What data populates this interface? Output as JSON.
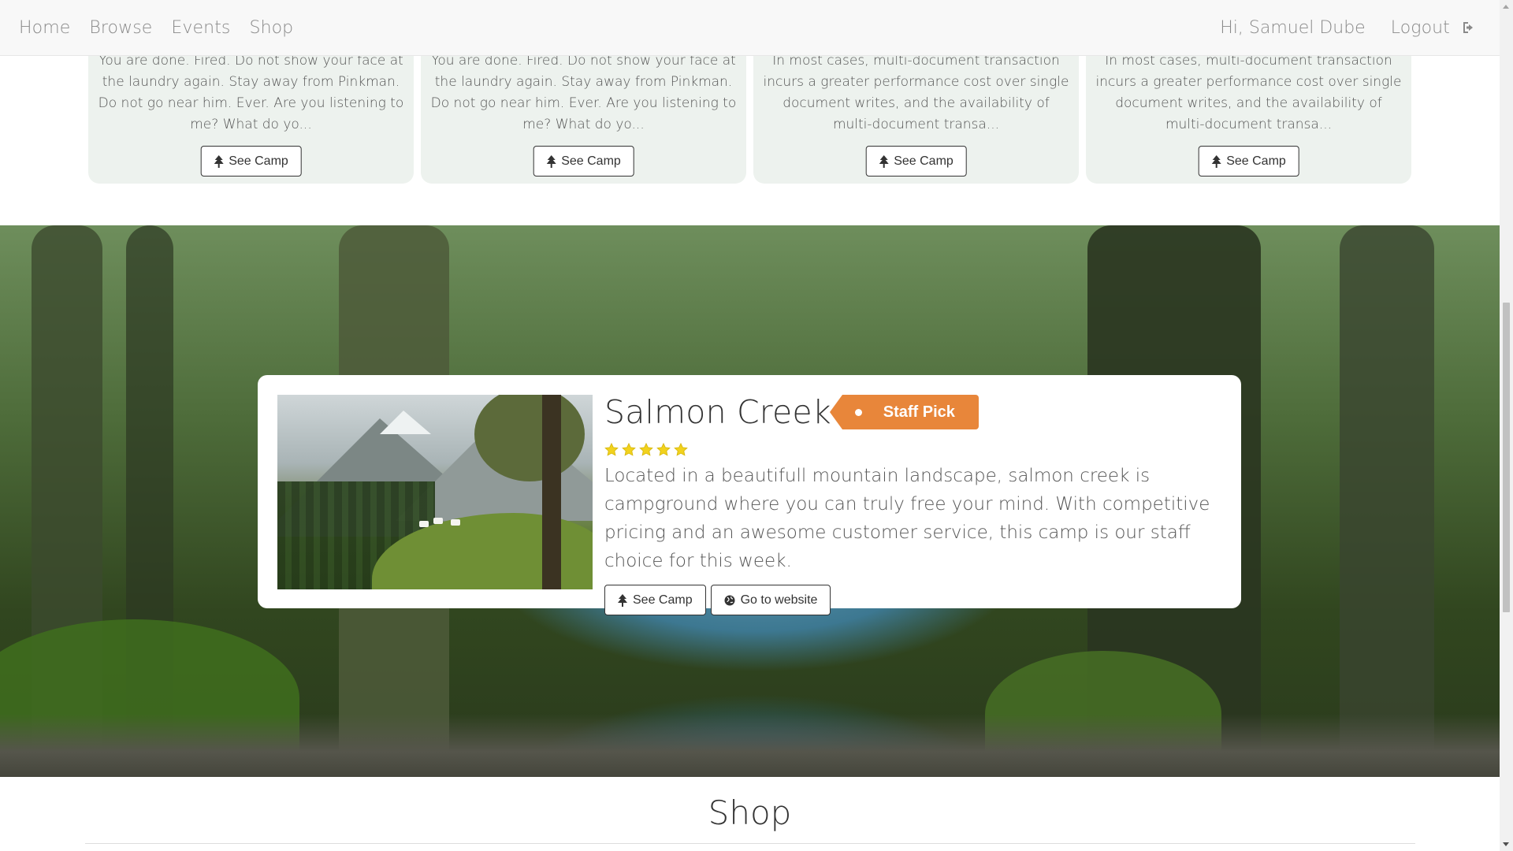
{
  "nav": {
    "links": [
      "Home",
      "Browse",
      "Events",
      "Shop"
    ],
    "greeting": "Hi, Samuel Dube",
    "logout": "Logout"
  },
  "cards": [
    {
      "text": "You are done. Fired. Do not show your face at the laundry again. Stay away from Pinkman. Do not go near him. Ever. Are you listening to me? What do yo...",
      "button": "See Camp"
    },
    {
      "text": "You are done. Fired. Do not show your face at the laundry again. Stay away from Pinkman. Do not go near him. Ever. Are you listening to me? What do yo...",
      "button": "See Camp"
    },
    {
      "text": "In most cases, multi-document transaction incurs a greater performance cost over single document writes, and the availability of multi-document transa...",
      "button": "See Camp"
    },
    {
      "text": "In most cases, multi-document transaction incurs a greater performance cost over single document writes, and the availability of multi-document transa...",
      "button": "See Camp"
    }
  ],
  "feature": {
    "title": "Salmon Creek",
    "badge": "Staff Pick",
    "rating": 5,
    "description": "Located in a beautifull mountain landscape, salmon creek is campground where you can truly free your mind. With competitive pricing and an awesome customer service, this camp is our staff choice for this week.",
    "see_camp": "See Camp",
    "website": "Go to website"
  },
  "shop": {
    "title": "Shop"
  },
  "colors": {
    "badge": "#e8863a",
    "card_bg": "#edf2ee",
    "star": "#f2d21d",
    "navbar": "#f8f8f8"
  },
  "icons": {
    "logout": "sign-out-icon",
    "tree": "tree-icon",
    "globe": "globe-icon",
    "star": "star-icon"
  }
}
